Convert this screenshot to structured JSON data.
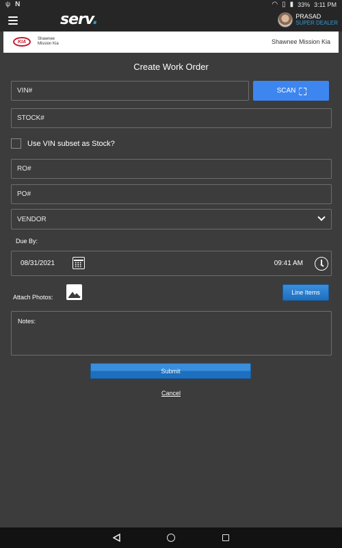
{
  "status_bar": {
    "battery": "33%",
    "time": "3:11 PM"
  },
  "app_bar": {
    "logo": "serv",
    "logo_dot": ".",
    "user_name": "PRASAD",
    "user_role": "SUPER DEALER"
  },
  "dealer_bar": {
    "brand_logo": "KIA",
    "dealer_small_line1": "Shawnee",
    "dealer_small_line2": "Mission Kia",
    "dealer_name": "Shawnee Mission Kia"
  },
  "form": {
    "title": "Create Work Order",
    "vin_placeholder": "VIN#",
    "scan_label": "SCAN",
    "stock_placeholder": "STOCK#",
    "vin_subset_label": "Use VIN subset as Stock?",
    "ro_placeholder": "RO#",
    "po_placeholder": "PO#",
    "vendor_selected": "VENDOR",
    "due_label": "Due By:",
    "due_date": "08/31/2021",
    "due_time": "09:41 AM",
    "attach_label": "Attach Photos:",
    "line_items_label": "Line Items",
    "notes_placeholder": "Notes:",
    "submit_label": "Submit",
    "cancel_label": "Cancel"
  },
  "colors": {
    "background": "#3c3c3c",
    "bar": "#262626",
    "accent_blue": "#3d86f0",
    "role_blue": "#2e9bd6",
    "kia_red": "#c4172c"
  },
  "icons": [
    "hamburger-icon",
    "scan-icon",
    "chevron-down-icon",
    "calendar-icon",
    "clock-icon",
    "image-icon",
    "back-icon",
    "home-icon",
    "recents-icon"
  ]
}
